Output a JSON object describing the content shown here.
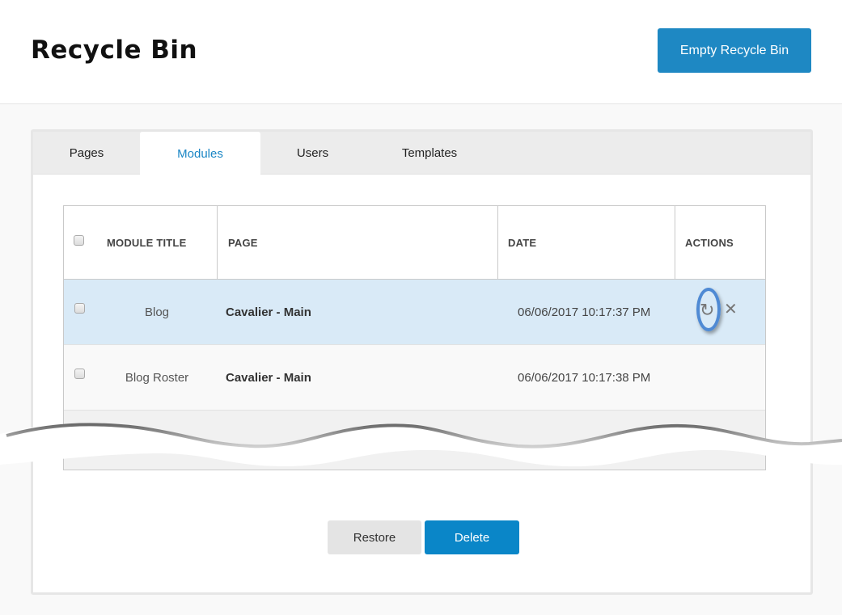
{
  "header": {
    "title": "Recycle Bin",
    "empty_button_label": "Empty Recycle Bin"
  },
  "tabs": [
    {
      "label": "Pages",
      "active": false
    },
    {
      "label": "Modules",
      "active": true
    },
    {
      "label": "Users",
      "active": false
    },
    {
      "label": "Templates",
      "active": false
    }
  ],
  "table": {
    "columns": [
      "MODULE TITLE",
      "PAGE",
      "DATE",
      "ACTIONS"
    ],
    "rows": [
      {
        "title": "Blog",
        "page": "Cavalier - Main",
        "date": "06/06/2017 10:17:37 PM",
        "highlighted": true,
        "actions": [
          "restore-icon",
          "delete-icon"
        ]
      },
      {
        "title": "Blog Roster",
        "page": "Cavalier - Main",
        "date": "06/06/2017 10:17:38 PM",
        "highlighted": false,
        "actions": []
      }
    ]
  },
  "icons": {
    "restore": "↻",
    "delete": "✕"
  },
  "footer": {
    "restore_label": "Restore",
    "delete_label": "Delete"
  },
  "colors": {
    "primary": "#1e88c3",
    "delete_button": "#0a86c8",
    "active_tab_text": "#1a86c5",
    "row_highlight": "#d9eaf7",
    "annotation_ring": "#4f8ad4"
  }
}
